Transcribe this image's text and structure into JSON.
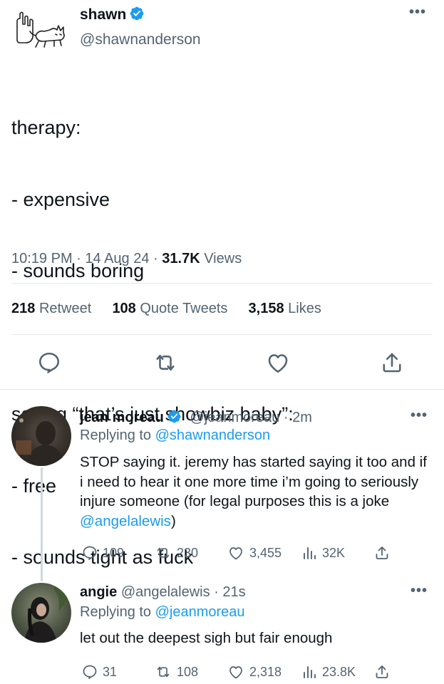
{
  "main_tweet": {
    "display_name": "shawn",
    "handle": "@shawnanderson",
    "text_lines": [
      "therapy:",
      "- expensive",
      "- sounds boring",
      "",
      "saying “that’s just showbiz baby”:",
      "- free",
      "- sounds tight as fuck"
    ],
    "time": "10:19 PM",
    "date": "14 Aug 24",
    "views_count": "31.7K",
    "views_label": "Views",
    "retweets_count": "218",
    "retweets_label": "Retweet",
    "quotes_count": "108",
    "quotes_label": "Quote Tweets",
    "likes_count": "3,158",
    "likes_label": "Likes"
  },
  "replies": [
    {
      "display_name": "jean moreau",
      "handle": "@jeanmoreau",
      "time": "2m",
      "replying_label": "Replying to",
      "replying_to": "@shawnanderson",
      "text": "STOP saying it. jeremy has started saying it too and if i need to hear it one more time i’m going to seriously injure someone (for legal purposes this is a joke ",
      "mention": "@angelalewis",
      "text_end": ")",
      "replies": "109",
      "retweets": "230",
      "likes": "3,455",
      "views": "32K"
    },
    {
      "display_name": "angie",
      "handle": "@angelalewis",
      "time": "21s",
      "replying_label": "Replying to",
      "replying_to": "@jeanmoreau",
      "text": "let out the deepest sigh but fair enough",
      "replies": "31",
      "retweets": "108",
      "likes": "2,318",
      "views": "23.8K"
    }
  ],
  "colors": {
    "accent": "#1d9bf0",
    "muted": "#536471",
    "text": "#0f1419",
    "divider": "#e5e8eb"
  },
  "icons": [
    "verified-badge-icon",
    "more-icon",
    "reply-icon",
    "retweet-icon",
    "like-icon",
    "share-icon",
    "views-icon"
  ]
}
